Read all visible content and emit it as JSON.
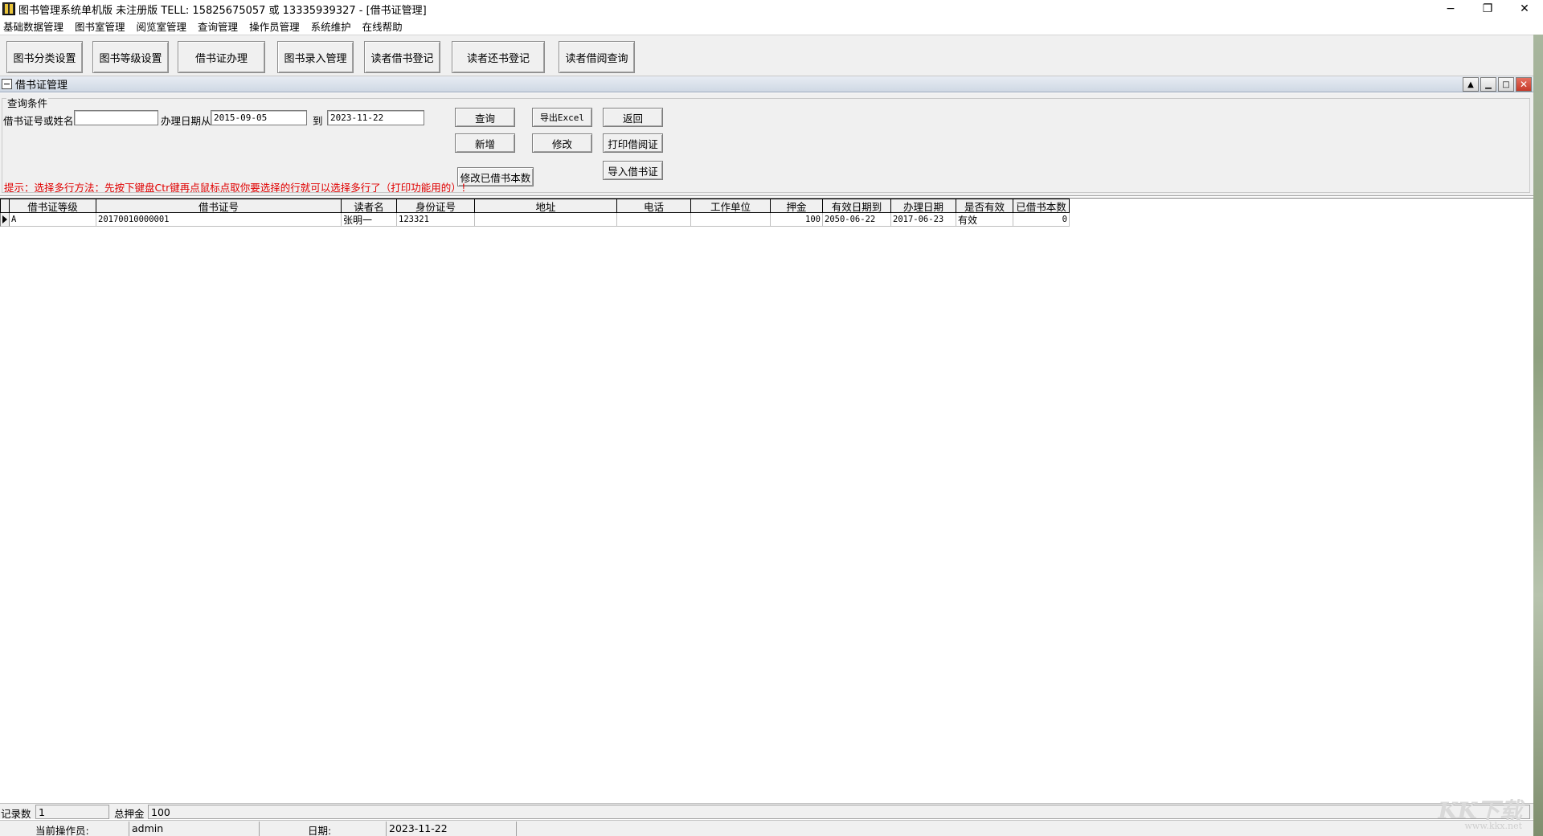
{
  "window": {
    "title": "图书管理系统单机版 未注册版 TELL: 15825675057 或 13335939327 - [借书证管理]",
    "minimize": "−",
    "restore": "❐",
    "close": "✕"
  },
  "menu": [
    "基础数据管理",
    "图书室管理",
    "阅览室管理",
    "查询管理",
    "操作员管理",
    "系统维护",
    "在线帮助"
  ],
  "toolbar": [
    "图书分类设置",
    "图书等级设置",
    "借书证办理",
    "图书录入管理",
    "读者借书登记",
    "读者还书登记",
    "读者借阅查询"
  ],
  "child": {
    "title": "借书证管理",
    "btn_up": "▲",
    "btn_min": "▁",
    "btn_max": "□",
    "btn_close": "✕"
  },
  "query": {
    "group_title": "查询条件",
    "label_card_or_name": "借书证号或姓名",
    "card_or_name_value": "",
    "label_date_from": "办理日期从",
    "date_from": "2015-09-05",
    "label_to": "到",
    "date_to": "2023-11-22",
    "btn_query": "查询",
    "btn_export": "导出Excel",
    "btn_back": "返回",
    "btn_add": "新增",
    "btn_edit": "修改",
    "btn_print": "打印借阅证",
    "btn_edit_count": "修改已借书本数",
    "btn_import": "导入借书证",
    "hint": "提示：选择多行方法：先按下键盘Ctr键再点鼠标点取你要选择的行就可以选择多行了（打印功能用的）！"
  },
  "grid": {
    "columns": [
      "借书证等级",
      "借书证号",
      "读者名",
      "身份证号",
      "地址",
      "电话",
      "工作单位",
      "押金",
      "有效日期到",
      "办理日期",
      "是否有效",
      "已借书本数"
    ],
    "rows": [
      {
        "level": "A",
        "card_no": "20170010000001",
        "name": "张明一",
        "id_no": "123321",
        "address": "",
        "phone": "",
        "work_unit": "",
        "deposit": "100",
        "valid_until": "2050-06-22",
        "issue_date": "2017-06-23",
        "valid": "有效",
        "borrowed": "0"
      }
    ]
  },
  "summary": {
    "label_records": "记录数",
    "records": "1",
    "label_total_deposit": "总押金",
    "total_deposit": "100"
  },
  "status": {
    "label_operator": "当前操作员:",
    "operator": "admin",
    "label_date": "日期:",
    "date": "2023-11-22"
  },
  "watermark": {
    "brand": "KK下载",
    "url": "www.kkx.net"
  }
}
